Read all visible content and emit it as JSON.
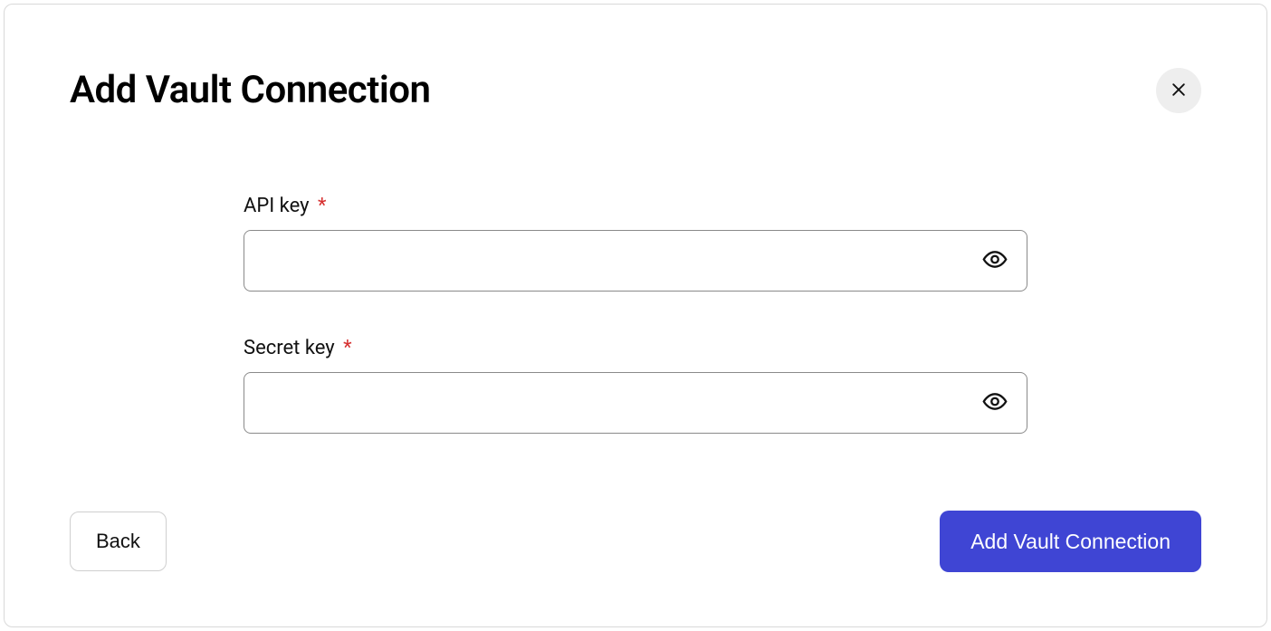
{
  "modal": {
    "title": "Add Vault Connection"
  },
  "form": {
    "api_key": {
      "label": "API key",
      "value": "",
      "required_marker": "*"
    },
    "secret_key": {
      "label": "Secret key",
      "value": "",
      "required_marker": "*"
    }
  },
  "footer": {
    "back_label": "Back",
    "submit_label": "Add Vault Connection"
  }
}
